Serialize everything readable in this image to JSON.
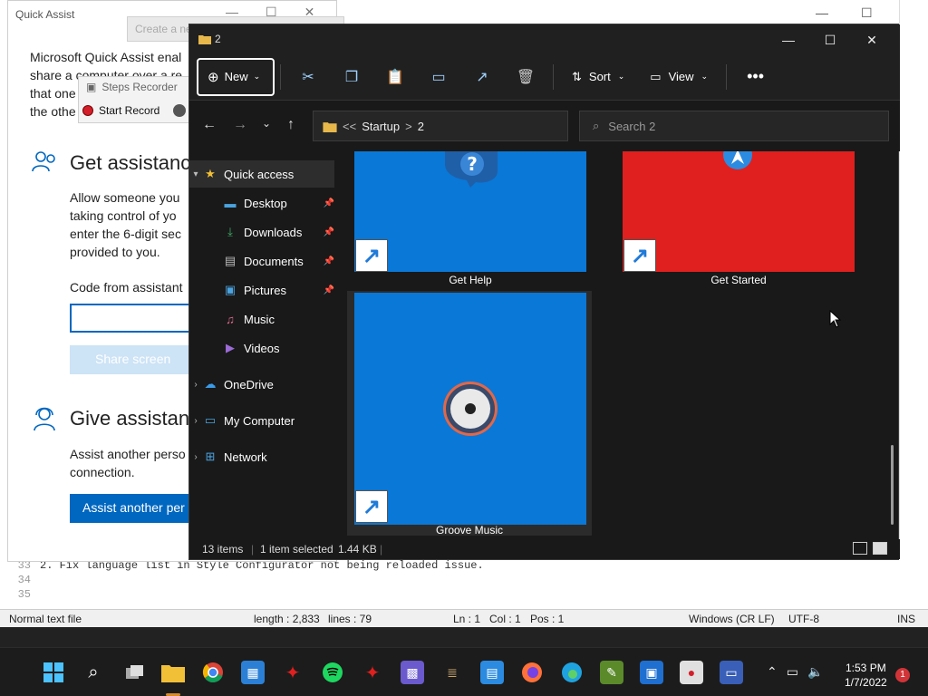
{
  "editor": {
    "lines": [
      {
        "num": "33",
        "text": "2.  Fix language list in Style Configurator not being reloaded issue."
      },
      {
        "num": "34",
        "text": ""
      },
      {
        "num": "35",
        "text": ""
      }
    ],
    "status": {
      "type": "Normal text file",
      "length": "length : 2,833",
      "lines": "lines : 79",
      "ln": "Ln : 1",
      "col": "Col : 1",
      "pos": "Pos : 1",
      "eol": "Windows (CR LF)",
      "encoding": "UTF-8",
      "mode": "INS"
    }
  },
  "quick_assist": {
    "title": "Quick Assist",
    "intro_lines": [
      "Microsoft Quick Assist enal",
      "share a computer over a re",
      "that one",
      "the othe"
    ],
    "get_heading": "Get assistanc",
    "get_desc": [
      "Allow someone you",
      "taking control of yo",
      "enter the 6-digit sec",
      "provided to you."
    ],
    "code_label": "Code from assistant",
    "share_button": "Share screen",
    "give_heading": "Give assistan",
    "give_desc": [
      "Assist another perso",
      "connection."
    ],
    "assist_button": "Assist another per"
  },
  "tooltip": {
    "text": "Create a new item in the current location."
  },
  "steps_recorder": {
    "title": "Steps Recorder",
    "start_label": "Start Record"
  },
  "explorer": {
    "title": "2",
    "toolbar": {
      "new_label": "New",
      "sort_label": "Sort",
      "view_label": "View"
    },
    "address": {
      "prefix": "<<",
      "segment1": "Startup",
      "separator": ">",
      "segment2": "2"
    },
    "search": {
      "placeholder": "Search 2"
    },
    "nav": [
      {
        "label": "Quick access"
      },
      {
        "label": "Desktop"
      },
      {
        "label": "Downloads"
      },
      {
        "label": "Documents"
      },
      {
        "label": "Pictures"
      },
      {
        "label": "Music"
      },
      {
        "label": "Videos"
      },
      {
        "label": "OneDrive"
      },
      {
        "label": "My Computer"
      },
      {
        "label": "Network"
      }
    ],
    "items": [
      {
        "label": "Get Help",
        "color": "#0a78d7"
      },
      {
        "label": "Get Started",
        "color": "#e0201e"
      },
      {
        "label": "Groove Music",
        "color": "#0a78d7"
      }
    ],
    "status": {
      "count": "13 items",
      "selected": "1 item selected",
      "size": "1.44 KB"
    }
  },
  "taskbar": {
    "time": "1:53 PM",
    "date": "1/7/2022",
    "notifications": "1"
  }
}
